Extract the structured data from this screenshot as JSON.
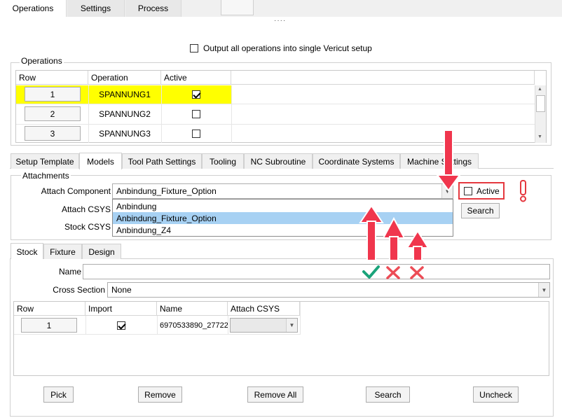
{
  "top_tabs": [
    "Operations",
    "Settings",
    "Process"
  ],
  "output_all_label": "Output all operations into single Vericut setup",
  "operations": {
    "title": "Operations",
    "headers": [
      "Row",
      "Operation",
      "Active"
    ],
    "rows": [
      {
        "row": "1",
        "name": "SPANNUNG1",
        "active": true,
        "highlight": true
      },
      {
        "row": "2",
        "name": "SPANNUNG2",
        "active": false
      },
      {
        "row": "3",
        "name": "SPANNUNG3",
        "active": false
      }
    ]
  },
  "mid_tabs": [
    "Setup Template",
    "Models",
    "Tool Path Settings",
    "Tooling",
    "NC Subroutine",
    "Coordinate Systems",
    "Machine Settings"
  ],
  "attachments": {
    "title": "Attachments",
    "attach_component_label": "Attach Component",
    "attach_component_value": "Anbindung_Fixture_Option",
    "attach_csys_label": "Attach CSYS",
    "stock_csys_label": "Stock CSYS",
    "active_label": "Active",
    "search_label": "Search",
    "dropdown_options": [
      "Anbindung",
      "Anbindung_Fixture_Option",
      "Anbindung_Z4"
    ],
    "selected_option_index": 1
  },
  "annotations": {
    "exclamation": "!",
    "marks": [
      "check",
      "cross",
      "cross"
    ],
    "arrow_color": "#f0364d",
    "check_color": "#1aa37a",
    "cross_color": "#ec4c56"
  },
  "stock_tabs": [
    "Stock",
    "Fixture",
    "Design"
  ],
  "stock": {
    "name_label": "Name",
    "name_value": "",
    "cross_section_label": "Cross Section",
    "cross_section_value": "None",
    "headers": [
      "Row",
      "Import",
      "Name",
      "Attach CSYS"
    ],
    "rows": [
      {
        "row": "1",
        "import": true,
        "name": "6970533890_27722",
        "attach_csys": ""
      }
    ]
  },
  "bottom_buttons": [
    "Pick",
    "Remove",
    "Remove All",
    "Search",
    "Uncheck"
  ],
  "colors": {
    "highlight": "#ffff00",
    "selection": "#a7d1f3"
  }
}
